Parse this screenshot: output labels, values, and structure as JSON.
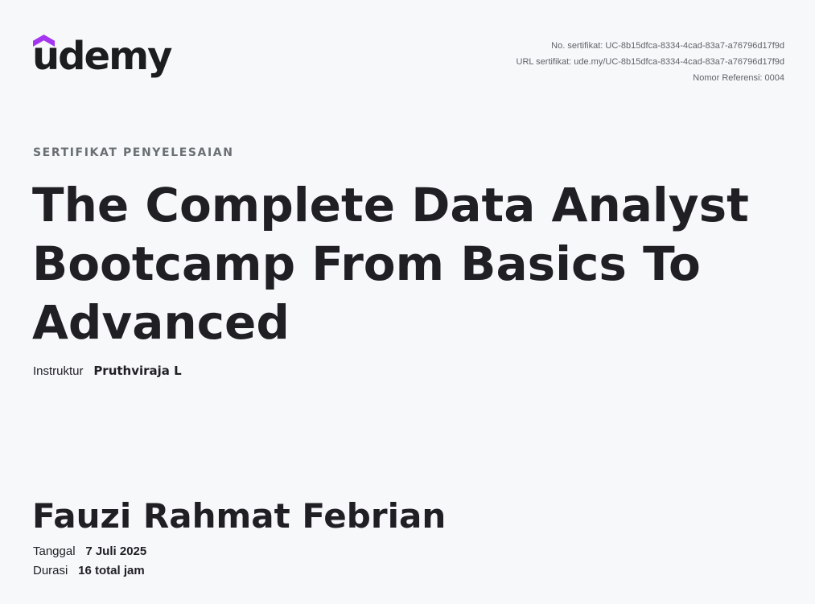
{
  "brand": {
    "logo_text": "udemy",
    "logo_accent_color": "#a435f0",
    "text_color": "#1c1d1f",
    "background_color": "#f7f8fa"
  },
  "meta": {
    "certificate_no": "No. sertifikat: UC-8b15dfca-8334-4cad-83a7-a76796d17f9d",
    "certificate_url": "URL sertifikat: ude.my/UC-8b15dfca-8334-4cad-83a7-a76796d17f9d",
    "reference_no": "Nomor Referensi: 0004"
  },
  "certificate": {
    "kicker": "SERTIFIKAT PENYELESAIAN",
    "course_title": "The Complete Data Analyst Bootcamp From Basics To Advanced",
    "instructor_label": "Instruktur",
    "instructor_name": "Pruthviraja L",
    "recipient_name": "Fauzi Rahmat Febrian",
    "date_label": "Tanggal",
    "date_value": "7 Juli 2025",
    "duration_label": "Durasi",
    "duration_value": "16 total jam"
  }
}
